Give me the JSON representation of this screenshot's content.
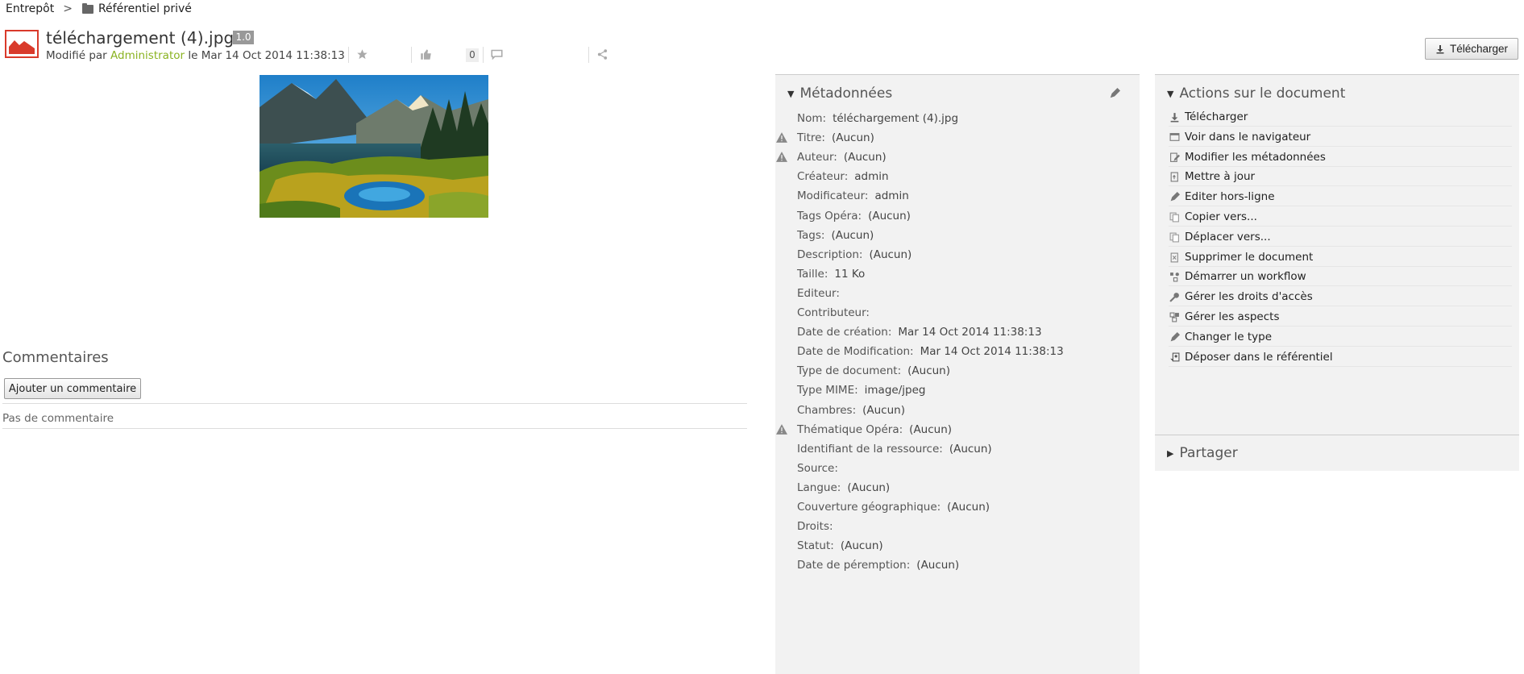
{
  "breadcrumb": {
    "root": "Entrepôt",
    "separator": ">",
    "current": "Référentiel privé"
  },
  "document": {
    "title": "téléchargement (4).jpg",
    "version": "1.0",
    "modified_prefix": "Modifié par",
    "modified_user": "Administrator",
    "modified_date": "le Mar 14 Oct 2014 11:38:13",
    "like_count": "0",
    "download_label": "Télécharger"
  },
  "comments": {
    "title": "Commentaires",
    "add_label": "Ajouter un commentaire",
    "empty_text": "Pas de commentaire"
  },
  "metadata": {
    "title": "Métadonnées",
    "rows": [
      {
        "label": "Nom:",
        "value": "téléchargement (4).jpg",
        "warning": false
      },
      {
        "label": "Titre:",
        "value": "(Aucun)",
        "warning": true
      },
      {
        "label": "Auteur:",
        "value": "(Aucun)",
        "warning": true
      },
      {
        "label": "Créateur:",
        "value": "admin",
        "warning": false
      },
      {
        "label": "Modificateur:",
        "value": "admin",
        "warning": false
      },
      {
        "label": "Tags Opéra:",
        "value": "(Aucun)",
        "warning": false
      },
      {
        "label": "Tags:",
        "value": "(Aucun)",
        "warning": false
      },
      {
        "label": "Description:",
        "value": "(Aucun)",
        "warning": false
      },
      {
        "label": "Taille:",
        "value": "11 Ko",
        "warning": false
      },
      {
        "label": "Editeur:",
        "value": "",
        "warning": false
      },
      {
        "label": "Contributeur:",
        "value": "",
        "warning": false
      },
      {
        "label": "Date de création:",
        "value": "Mar 14 Oct 2014 11:38:13",
        "warning": false
      },
      {
        "label": "Date de Modification:",
        "value": "Mar 14 Oct 2014 11:38:13",
        "warning": false
      },
      {
        "label": "Type de document:",
        "value": "(Aucun)",
        "warning": false
      },
      {
        "label": "Type MIME:",
        "value": "image/jpeg",
        "warning": false
      },
      {
        "label": "Chambres:",
        "value": "(Aucun)",
        "warning": false
      },
      {
        "label": "Thématique Opéra:",
        "value": "(Aucun)",
        "warning": true
      },
      {
        "label": "Identifiant de la ressource:",
        "value": "(Aucun)",
        "warning": false
      },
      {
        "label": "Source:",
        "value": "",
        "warning": false
      },
      {
        "label": "Langue:",
        "value": "(Aucun)",
        "warning": false
      },
      {
        "label": "Couverture géographique:",
        "value": "(Aucun)",
        "warning": false
      },
      {
        "label": "Droits:",
        "value": "",
        "warning": false
      },
      {
        "label": "Statut:",
        "value": "(Aucun)",
        "warning": false
      },
      {
        "label": "Date de péremption:",
        "value": "(Aucun)",
        "warning": false
      }
    ]
  },
  "actions": {
    "title": "Actions sur le document",
    "items": [
      {
        "label": "Télécharger",
        "icon": "download-icon"
      },
      {
        "label": "Voir dans le navigateur",
        "icon": "browser-icon"
      },
      {
        "label": "Modifier les métadonnées",
        "icon": "edit-properties-icon"
      },
      {
        "label": "Mettre à jour",
        "icon": "upload-new-version-icon"
      },
      {
        "label": "Editer hors-ligne",
        "icon": "pencil-icon"
      },
      {
        "label": "Copier vers...",
        "icon": "copy-icon"
      },
      {
        "label": "Déplacer vers...",
        "icon": "move-icon"
      },
      {
        "label": "Supprimer le document",
        "icon": "delete-icon"
      },
      {
        "label": "Démarrer un workflow",
        "icon": "workflow-icon"
      },
      {
        "label": "Gérer les droits d'accès",
        "icon": "key-icon"
      },
      {
        "label": "Gérer les aspects",
        "icon": "aspects-icon"
      },
      {
        "label": "Changer le type",
        "icon": "pencil-icon"
      },
      {
        "label": "Déposer dans le référentiel",
        "icon": "deposit-icon"
      }
    ],
    "share_title": "Partager"
  },
  "colors": {
    "accent_user": "#8ab321",
    "icon_red": "#d93a2b",
    "panel_bg": "#f2f2f2"
  }
}
